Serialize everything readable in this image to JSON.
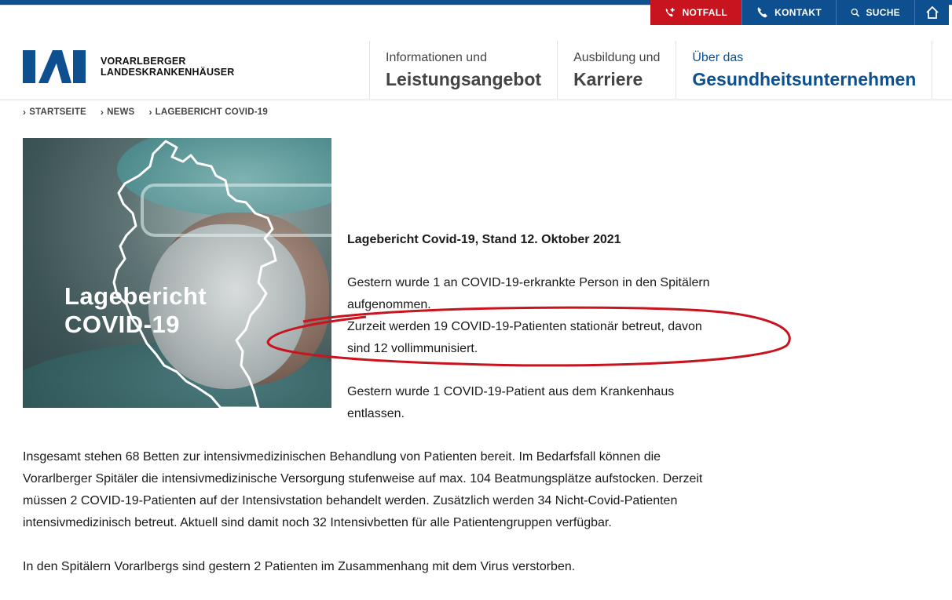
{
  "utility": {
    "notfall": "NOTFALL",
    "kontakt": "KONTAKT",
    "suche": "SUCHE",
    "colors": {
      "emergency": "#c8141e",
      "primary": "#0d4f8f"
    }
  },
  "logo": {
    "line1": "VORARLBERGER",
    "line2": "LANDESKRANKENHÄUSER"
  },
  "nav": [
    {
      "small": "Informationen und",
      "big": "Leistungsangebot"
    },
    {
      "small": "Ausbildung und",
      "big": "Karriere"
    },
    {
      "small": "Über das",
      "big": "Gesundheitsunternehmen"
    }
  ],
  "breadcrumb": [
    "STARTSEITE",
    "NEWS",
    "LAGEBERICHT COVID-19"
  ],
  "hero": {
    "line1": "Lagebericht",
    "line2": "COVID-19"
  },
  "article": {
    "headline": "Lagebericht Covid-19, Stand 12. Oktober 2021",
    "p1": "Gestern wurde 1 an COVID-19-erkrankte Person in den Spitälern aufgenommen.",
    "p2": "Zurzeit werden 19 COVID-19-Patienten stationär betreut, davon sind 12 vollimmunisiert.",
    "p3": "Gestern wurde 1 COVID-19-Patient aus dem Krankenhaus entlassen.",
    "p4": "Insgesamt stehen 68 Betten zur intensivmedizinischen Behandlung von Patienten bereit. Im Bedarfsfall können die Vorarlberger Spitäler die intensivmedizinische Versorgung stufenweise auf max. 104 Beatmungsplätze aufstocken. Derzeit müssen 2 COVID-19-Patienten auf der Intensivstation behandelt werden. Zusätzlich werden 34 Nicht-Covid-Patienten intensivmedizinisch betreut. Aktuell sind damit noch 32 Intensivbetten für alle Patientengruppen verfügbar.",
    "p5": "In den Spitälern Vorarlbergs sind gestern 2  Patienten im Zusammenhang mit dem Virus verstorben."
  }
}
